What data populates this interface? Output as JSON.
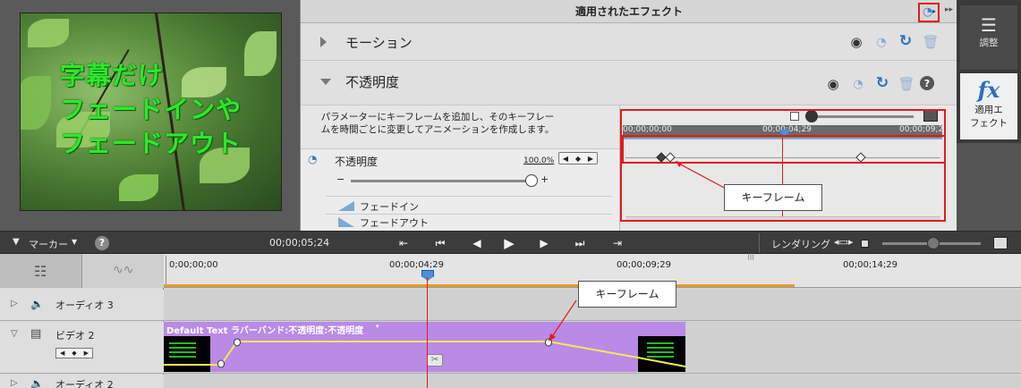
{
  "monitor": {
    "video_text_lines": [
      "字幕だけ",
      "フェードインや",
      "フェードアウト"
    ]
  },
  "effects_panel": {
    "title": "適用されたエフェクト",
    "effects": [
      {
        "name": "モーション",
        "expanded": false
      },
      {
        "name": "不透明度",
        "expanded": true
      }
    ],
    "description": "パラメーターにキーフレームを追加し、そのキーフレームを時間ごとに変更してアニメーションを作成します。",
    "param_name": "不透明度",
    "param_value": "100.0%",
    "slider_minus": "−",
    "slider_plus": "+",
    "slider_value_percent": 100,
    "fade_in": "フェードイン",
    "fade_out": "フェードアウト",
    "kf_timecodes": [
      "00;00;00;00",
      "00;00;04;29",
      "00;00;09;2"
    ],
    "callout": "キーフレーム"
  },
  "sidebar": {
    "adjust": "調整",
    "applied_fx_line1": "適用エ",
    "applied_fx_line2": "フェクト",
    "fx_glyph": "fx"
  },
  "transport": {
    "marker": "マーカー",
    "help": "?",
    "timecode": "00;00;05;24",
    "rendering": "レンダリング"
  },
  "timeline": {
    "ruler_labels": [
      "0;00;00;00",
      "00;00;04;29",
      "00;00;09;29",
      "00;00;14;29"
    ],
    "tracks": [
      {
        "name": "オーディオ 3"
      },
      {
        "name": "ビデオ 2"
      },
      {
        "name": "オーディオ 2"
      }
    ],
    "clip_label": "Default Text ラバーバンド:不透明度:不透明度",
    "callout": "キーフレーム"
  },
  "colors": {
    "accent_red": "#e21b1b",
    "clip_purple": "#b98ae6",
    "rubber_band": "#f2e85a",
    "playhead_blue": "#4a90d9"
  }
}
